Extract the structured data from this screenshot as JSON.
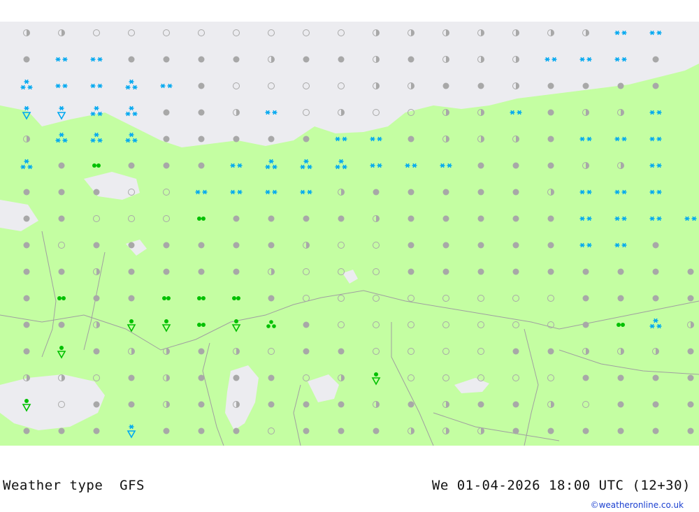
{
  "footer": {
    "product": "Weather type  GFS",
    "valid_time": "We 01-04-2026 18:00 UTC (12+30)",
    "credit": "©weatheronline.co.uk"
  },
  "colors": {
    "land": "#c4fea2",
    "sea": "#ececf0",
    "border": "#a0a0a0",
    "dry_marker": "#a8a8a8",
    "snow": "#00a8f0",
    "rain": "#00c000"
  },
  "legend_symbols": {
    "dry_full": "filled grey dot",
    "dry_half": "half-filled grey dot",
    "dry_empty": "open grey circle",
    "snow_light": "**",
    "snow_moderate": "three-asterisk cluster",
    "snow_shower": "asterisk over triangle",
    "rain": "two green dots",
    "rain_moderate": "three green dots",
    "rain_shower": "green dot over triangle"
  },
  "grid": {
    "rows": [
      "hhoooooooohhhhhhhSS",
      "fSSffffhffhfhhhSSSf",
      "MSSMSfoooohhffhffff",
      "WWMMffhSohoohhSfhhS",
      "hMMMfffffSSfhhhfSSS",
      "MfRfffSMMMSSSfffhhS",
      "fffooSSSShfffffhSSS",
      "ffooeRffffhfffffSSSS",
      "foffffffhoofffffSSf",
      "ffhffffhooofffffffff",
      "fRffRRRfoooooooofffff",
      "ffhVVRVTfooooooofRMhf",
      "fVfhhfhoffooooffhhhf",
      "hhofhfffohVooooofffff",
      "VoffhfhfffhfhffhoffF",
      "fffwfffofffhhhffffff"
    ]
  }
}
